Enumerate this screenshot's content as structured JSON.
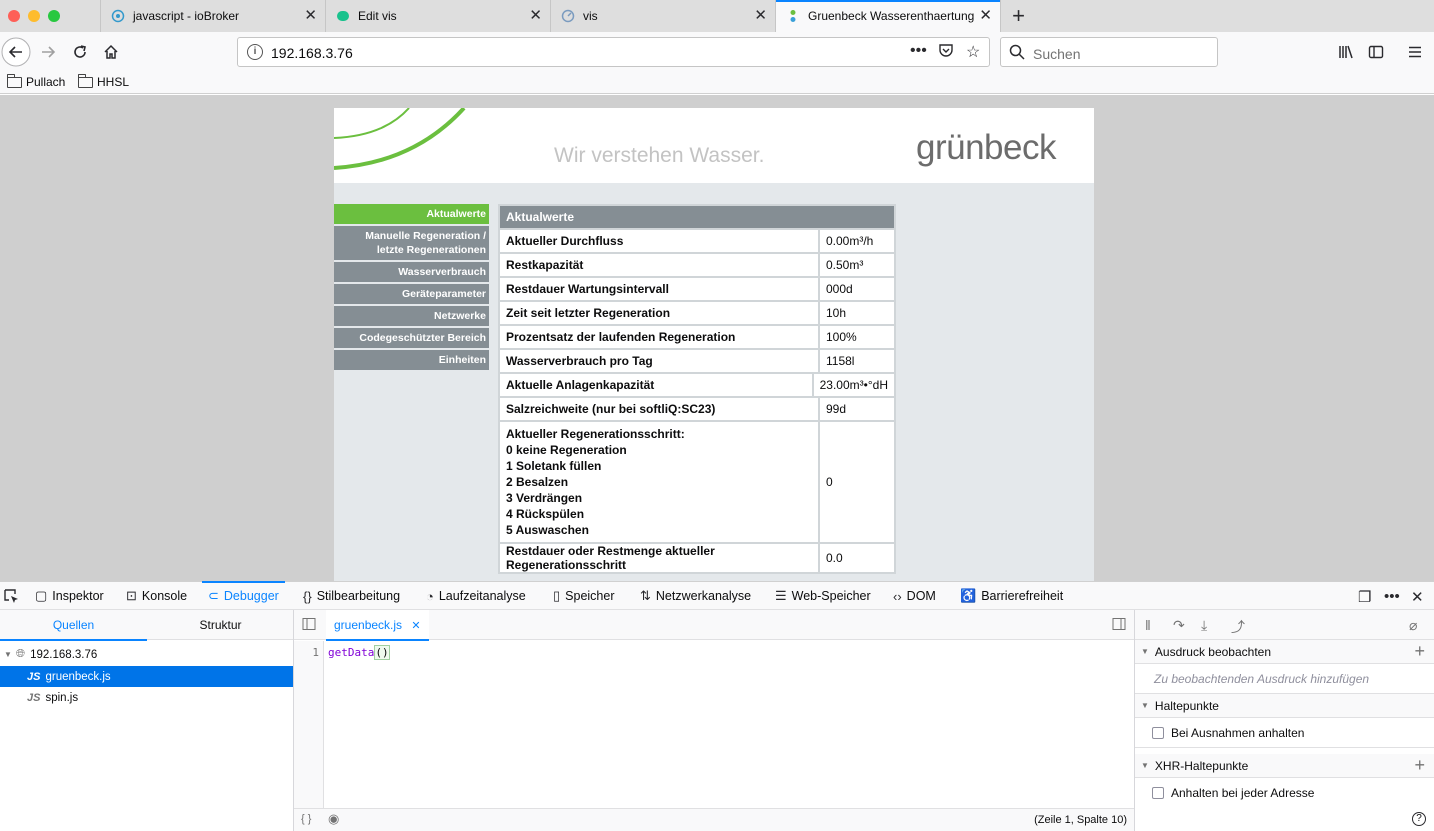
{
  "browser": {
    "tabs": [
      {
        "title": "javascript - ioBroker"
      },
      {
        "title": "Edit vis"
      },
      {
        "title": "vis"
      },
      {
        "title": "Gruenbeck Wasserenthaertung"
      }
    ],
    "url": "192.168.3.76",
    "search_placeholder": "Suchen",
    "bookmarks": [
      "Pullach",
      "HHSL"
    ]
  },
  "page": {
    "slogan": "Wir verstehen Wasser.",
    "brand": "grünbeck",
    "menu": [
      "Aktualwerte",
      "Manuelle Regeneration / letzte Regenerationen",
      "Wasserverbrauch",
      "Geräteparameter",
      "Netzwerke",
      "Codegeschützter Bereich",
      "Einheiten"
    ],
    "table_title": "Aktualwerte",
    "rows": [
      {
        "label": "Aktueller Durchfluss",
        "value": "0.00m³/h"
      },
      {
        "label": "Restkapazität",
        "value": "0.50m³"
      },
      {
        "label": "Restdauer Wartungsintervall",
        "value": "000d"
      },
      {
        "label": "Zeit seit letzter Regeneration",
        "value": "10h"
      },
      {
        "label": "Prozentsatz der laufenden Regeneration",
        "value": "100%"
      },
      {
        "label": "Wasserverbrauch pro Tag",
        "value": "1158l"
      },
      {
        "label": "Aktuelle Anlagenkapazität",
        "value": "23.00m³•°dH"
      },
      {
        "label": "Salzreichweite (nur bei softliQ:SC23)",
        "value": "99d"
      }
    ],
    "regen_lines": [
      "Aktueller Regenerationsschritt:",
      "0 keine Regeneration",
      "1 Soletank füllen",
      "2 Besalzen",
      "3 Verdrängen",
      "4 Rückspülen",
      "5 Auswaschen"
    ],
    "regen_value": "0",
    "last_row": {
      "label": "Restdauer oder Restmenge aktueller Regenerationsschritt",
      "value": "0.0"
    }
  },
  "devtools": {
    "tabs": [
      "Inspektor",
      "Konsole",
      "Debugger",
      "Stilbearbeitung",
      "Laufzeitanalyse",
      "Speicher",
      "Netzwerkanalyse",
      "Web-Speicher",
      "DOM",
      "Barrierefreiheit"
    ],
    "sources_tabs": [
      "Quellen",
      "Struktur"
    ],
    "tree": {
      "host": "192.168.3.76",
      "files": [
        "gruenbeck.js",
        "spin.js"
      ]
    },
    "file_badge": "JS",
    "editor_tab": "gruenbeck.js",
    "line_number": "1",
    "code_fn": "getData",
    "code_parens": "()",
    "footer_left": "{ }",
    "position": "(Zeile 1, Spalte 10)",
    "watch_title": "Ausdruck beobachten",
    "watch_placeholder": "Zu beobachtenden Ausdruck hinzufügen",
    "breakpoints_title": "Haltepunkte",
    "exceptions_label": "Bei Ausnahmen anhalten",
    "xhr_title": "XHR-Haltepunkte",
    "xhr_label": "Anhalten bei jeder Adresse",
    "help": "?"
  },
  "colors": {
    "accent": "#0a84ff",
    "gruenbeck_green": "#6bbf3f",
    "menu_grey": "#858e94"
  }
}
